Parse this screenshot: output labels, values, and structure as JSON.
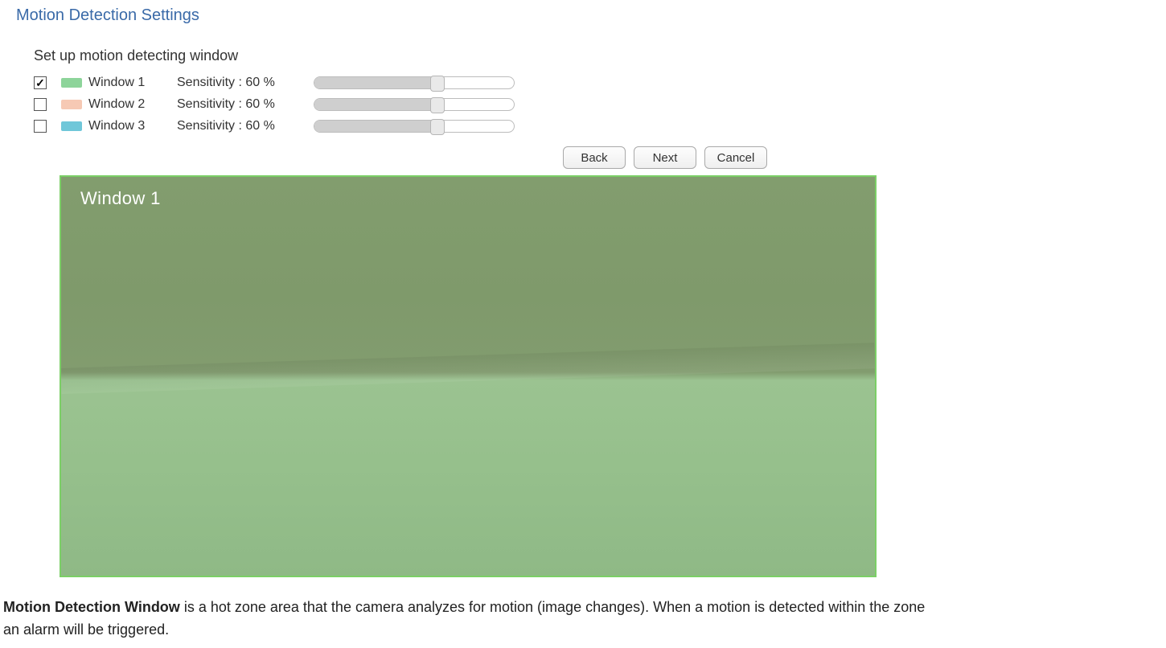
{
  "title": "Motion Detection Settings",
  "subtitle": "Set up motion detecting window",
  "windows": [
    {
      "checked": true,
      "swatch": "swatch-green",
      "label": "Window 1",
      "sensitivity_text": "Sensitivity : 60 %",
      "value": 60
    },
    {
      "checked": false,
      "swatch": "swatch-peach",
      "label": "Window 2",
      "sensitivity_text": "Sensitivity : 60 %",
      "value": 60
    },
    {
      "checked": false,
      "swatch": "swatch-blue",
      "label": "Window 3",
      "sensitivity_text": "Sensitivity : 60 %",
      "value": 60
    }
  ],
  "buttons": {
    "back": "Back",
    "next": "Next",
    "cancel": "Cancel"
  },
  "preview": {
    "caption": "Window 1"
  },
  "explain": {
    "bold": "Motion Detection Window",
    "rest1": " is a hot zone area that the camera analyzes for motion (image changes). When a motion is detected within the zone",
    "rest2": "an alarm will be triggered."
  }
}
